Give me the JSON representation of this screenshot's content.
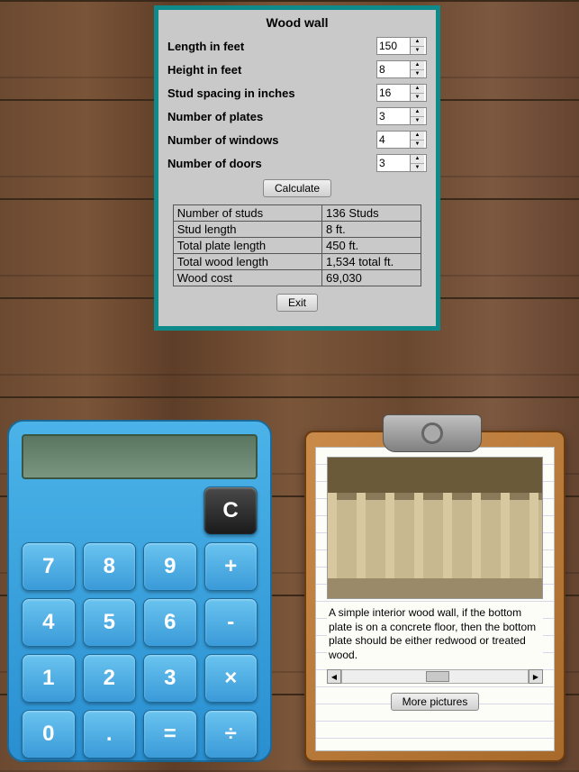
{
  "panel": {
    "title": "Wood wall",
    "fields": {
      "length": {
        "label": "Length in feet",
        "value": "150"
      },
      "height": {
        "label": "Height in feet",
        "value": "8"
      },
      "spacing": {
        "label": "Stud spacing in inches",
        "value": "16"
      },
      "plates": {
        "label": "Number of plates",
        "value": "3"
      },
      "windows": {
        "label": "Number of windows",
        "value": "4"
      },
      "doors": {
        "label": "Number of doors",
        "value": "3"
      }
    },
    "calculate_label": "Calculate",
    "exit_label": "Exit",
    "results": {
      "studs": {
        "label": "Number of studs",
        "value": "136 Studs"
      },
      "stud_length": {
        "label": "Stud length",
        "value": "8 ft."
      },
      "plate_length": {
        "label": "Total plate length",
        "value": "450 ft."
      },
      "wood_length": {
        "label": "Total wood length",
        "value": "1,534 total ft."
      },
      "cost": {
        "label": "Wood cost",
        "value": "69,030"
      }
    }
  },
  "calculator": {
    "keys_row1": [
      "C"
    ],
    "keys_row2": [
      "7",
      "8",
      "9",
      "+"
    ],
    "keys_row3": [
      "4",
      "5",
      "6",
      "-"
    ],
    "keys_row4": [
      "1",
      "2",
      "3",
      "×"
    ],
    "keys_row5": [
      "0",
      ".",
      "=",
      "÷"
    ]
  },
  "clipboard": {
    "caption": "A simple interior wood wall, if the bottom plate is on a concrete floor, then the bottom plate should be either redwood or treated wood.",
    "more_label": "More pictures"
  }
}
